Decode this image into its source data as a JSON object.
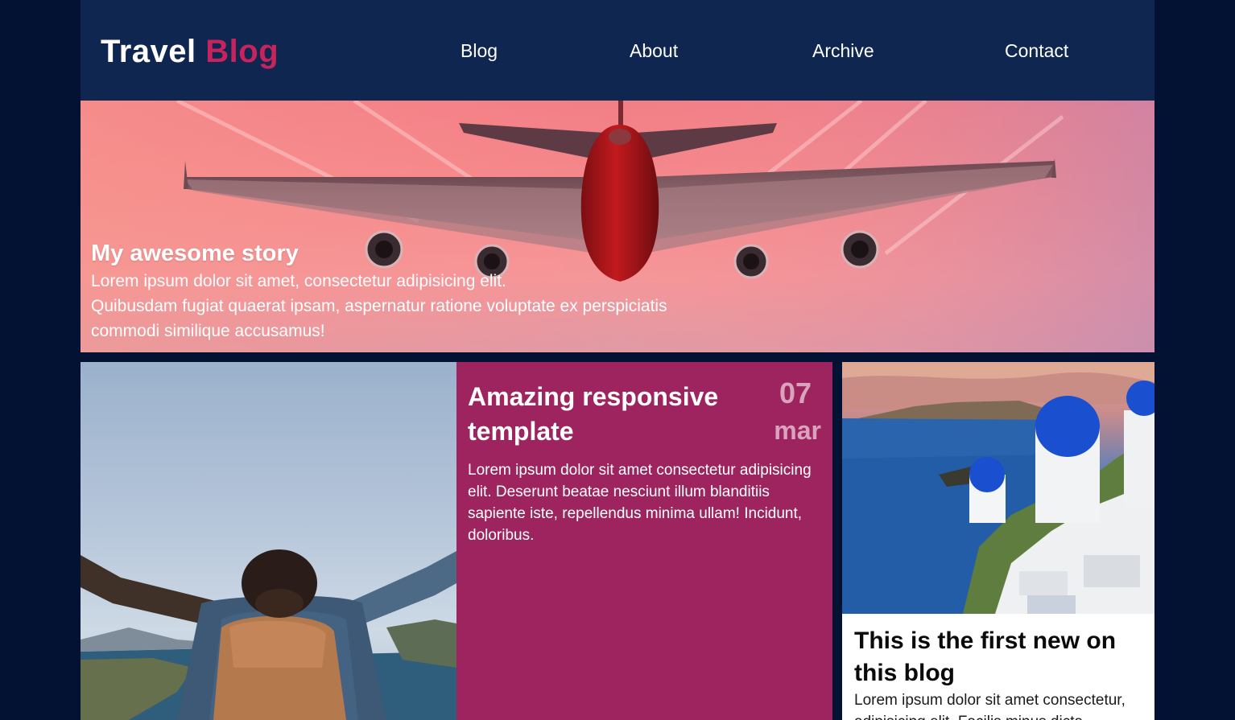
{
  "header": {
    "logo_part1": "Travel",
    "logo_part2": "Blog",
    "nav": [
      "Blog",
      "About",
      "Archive",
      "Contact"
    ]
  },
  "hero": {
    "title": "My awesome story",
    "line1": "Lorem ipsum dolor sit amet, consectetur adipisicing elit.",
    "line2": "Quibusdam fugiat quaerat ipsam, aspernatur ratione voluptate ex perspiciatis",
    "line3": "commodi similique accusamus!"
  },
  "post_featured": {
    "title": "Amazing responsive template",
    "day": "07",
    "month": "mar",
    "body": "Lorem ipsum dolor sit amet consectetur adipisicing elit. Deserunt beatae nesciunt illum blanditiis sapiente iste, repellendus minima ullam! Incidunt, doloribus."
  },
  "post_side": {
    "title": "This is the first new on this blog",
    "body": "Lorem ipsum dolor sit amet consectetur, adipisicing elit. Facilis minus dicta"
  },
  "colors": {
    "background": "#031233",
    "header": "#0f2650",
    "accent": "#c7235c",
    "card": "#9d245e"
  }
}
